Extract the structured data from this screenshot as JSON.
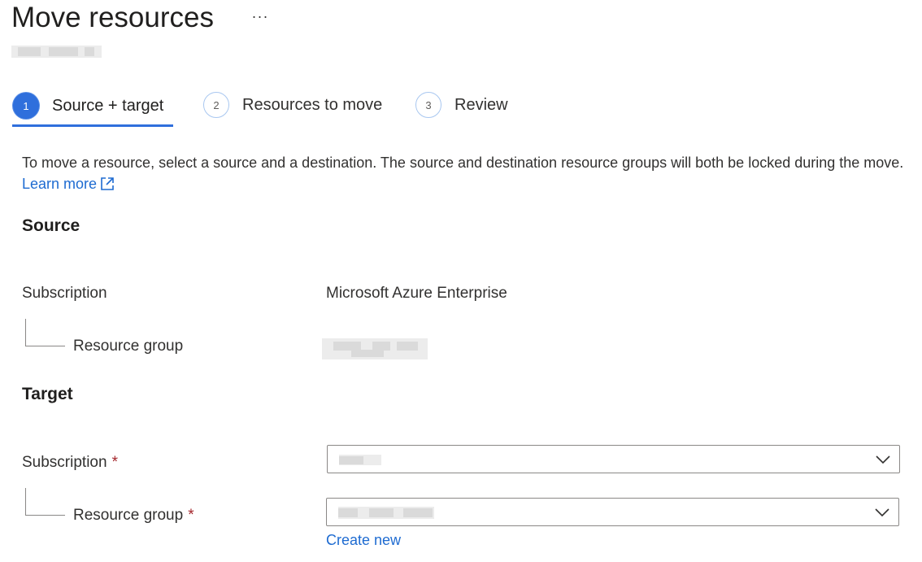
{
  "header": {
    "title": "Move resources",
    "more_label": "···",
    "more_icon": "ellipsis-icon"
  },
  "steps": [
    {
      "number": "1",
      "label": "Source + target",
      "active": true
    },
    {
      "number": "2",
      "label": "Resources to move",
      "active": false
    },
    {
      "number": "3",
      "label": "Review",
      "active": false
    }
  ],
  "description": {
    "text": "To move a resource, select a source and a destination. The source and destination resource groups will both be locked during the move.",
    "link_label": "Learn more",
    "link_icon": "external-link-icon"
  },
  "source": {
    "title": "Source",
    "subscription_label": "Subscription",
    "subscription_value": "Microsoft Azure Enterprise",
    "resource_group_label": "Resource group"
  },
  "target": {
    "title": "Target",
    "subscription_label": "Subscription",
    "resource_group_label": "Resource group",
    "required_mark": "*",
    "dropdown_icon": "chevron-down-icon",
    "create_new_label": "Create new"
  },
  "colors": {
    "accent": "#2f6fdc",
    "link": "#1e6bd1",
    "required": "#a4262c"
  }
}
